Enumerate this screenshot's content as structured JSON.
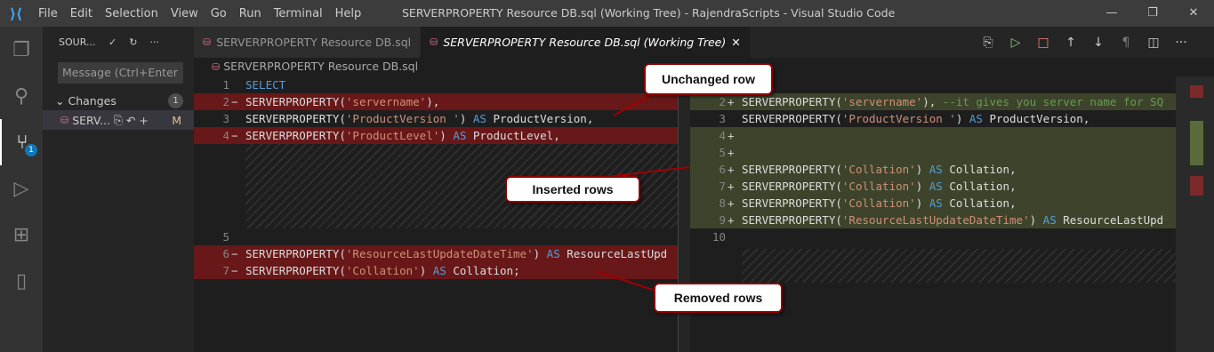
{
  "titlebar": {
    "menu": [
      "File",
      "Edit",
      "Selection",
      "View",
      "Go",
      "Run",
      "Terminal",
      "Help"
    ],
    "title": "SERVERPROPERTY Resource DB.sql (Working Tree) - RajendraScripts - Visual Studio Code"
  },
  "sidebar": {
    "title": "SOUR...",
    "message_placeholder": "Message (Ctrl+Enter ...",
    "changes_label": "Changes",
    "changes_count": "1",
    "file_name": "SERV...",
    "file_status": "M"
  },
  "activity_badge": "1",
  "tabs": [
    {
      "label": "SERVERPROPERTY Resource DB.sql"
    },
    {
      "label": "SERVERPROPERTY Resource DB.sql (Working Tree)"
    }
  ],
  "breadcrumb": "SERVERPROPERTY Resource DB.sql",
  "left_lines": [
    {
      "n": "1",
      "mark": " ",
      "type": "normal",
      "code": [
        [
          "kw",
          "SELECT"
        ]
      ]
    },
    {
      "n": "2",
      "mark": "−",
      "type": "del",
      "code": [
        [
          "txt",
          "SERVERPROPERTY("
        ],
        [
          "str",
          "'servername'"
        ],
        [
          "txt",
          "),"
        ]
      ]
    },
    {
      "n": "3",
      "mark": " ",
      "type": "normal",
      "code": [
        [
          "txt",
          "SERVERPROPERTY("
        ],
        [
          "str",
          "'ProductVersion '"
        ],
        [
          "txt",
          ") "
        ],
        [
          "kw",
          "AS"
        ],
        [
          "txt",
          " ProductVersion,"
        ]
      ]
    },
    {
      "n": "4",
      "mark": "−",
      "type": "del",
      "code": [
        [
          "txt",
          "SERVERPROPERTY("
        ],
        [
          "str",
          "'ProductLevel'"
        ],
        [
          "txt",
          ") "
        ],
        [
          "kw",
          "AS"
        ],
        [
          "txt",
          " ProductLevel,"
        ]
      ]
    }
  ],
  "left_lines2": [
    {
      "n": "5",
      "mark": " ",
      "type": "normal",
      "code": []
    },
    {
      "n": "6",
      "mark": "−",
      "type": "del",
      "code": [
        [
          "txt",
          "SERVERPROPERTY("
        ],
        [
          "str",
          "'ResourceLastUpdateDateTime'"
        ],
        [
          "txt",
          ") "
        ],
        [
          "kw",
          "AS"
        ],
        [
          "txt",
          " ResourceLastUpd"
        ]
      ]
    },
    {
      "n": "7",
      "mark": "−",
      "type": "del",
      "code": [
        [
          "txt",
          "SERVERPROPERTY("
        ],
        [
          "str",
          "'Collation'"
        ],
        [
          "txt",
          ") "
        ],
        [
          "kw",
          "AS"
        ],
        [
          "txt",
          " Collation;"
        ]
      ]
    }
  ],
  "right_lines": [
    {
      "n": "",
      "mark": " ",
      "type": "normal",
      "code": [
        [
          "kw",
          "CT"
        ]
      ]
    },
    {
      "n": "2",
      "mark": "+",
      "type": "ins",
      "code": [
        [
          "txt",
          "SERVERPROPERTY("
        ],
        [
          "str",
          "'servername'"
        ],
        [
          "txt",
          "), "
        ],
        [
          "cm",
          "--it gives you server name for SQ"
        ]
      ]
    },
    {
      "n": "3",
      "mark": " ",
      "type": "normal",
      "code": [
        [
          "txt",
          "SERVERPROPERTY("
        ],
        [
          "str",
          "'ProductVersion '"
        ],
        [
          "txt",
          ") "
        ],
        [
          "kw",
          "AS"
        ],
        [
          "txt",
          " ProductVersion,"
        ]
      ]
    },
    {
      "n": "4",
      "mark": "+",
      "type": "ins",
      "code": []
    },
    {
      "n": "5",
      "mark": "+",
      "type": "ins",
      "code": []
    },
    {
      "n": "6",
      "mark": "+",
      "type": "ins",
      "code": [
        [
          "txt",
          "SERVERPROPERTY("
        ],
        [
          "str",
          "'Collation'"
        ],
        [
          "txt",
          ") "
        ],
        [
          "kw",
          "AS"
        ],
        [
          "txt",
          " Collation,"
        ]
      ]
    },
    {
      "n": "7",
      "mark": "+",
      "type": "ins",
      "code": [
        [
          "txt",
          "SERVERPROPERTY("
        ],
        [
          "str",
          "'Collation'"
        ],
        [
          "txt",
          ") "
        ],
        [
          "kw",
          "AS"
        ],
        [
          "txt",
          " Collation,"
        ]
      ]
    },
    {
      "n": "8",
      "mark": "+",
      "type": "ins",
      "code": [
        [
          "txt",
          "SERVERPROPERTY("
        ],
        [
          "str",
          "'Collation'"
        ],
        [
          "txt",
          ") "
        ],
        [
          "kw",
          "AS"
        ],
        [
          "txt",
          " Collation,"
        ]
      ]
    },
    {
      "n": "9",
      "mark": "+",
      "type": "ins",
      "code": [
        [
          "txt",
          "SERVERPROPERTY("
        ],
        [
          "str",
          "'ResourceLastUpdateDateTime'"
        ],
        [
          "txt",
          ") "
        ],
        [
          "kw",
          "AS"
        ],
        [
          "txt",
          " ResourceLastUpd"
        ]
      ]
    },
    {
      "n": "10",
      "mark": " ",
      "type": "normal",
      "code": []
    }
  ],
  "callouts": {
    "unchanged": "Unchanged row",
    "inserted": "Inserted rows",
    "removed": "Removed rows"
  }
}
